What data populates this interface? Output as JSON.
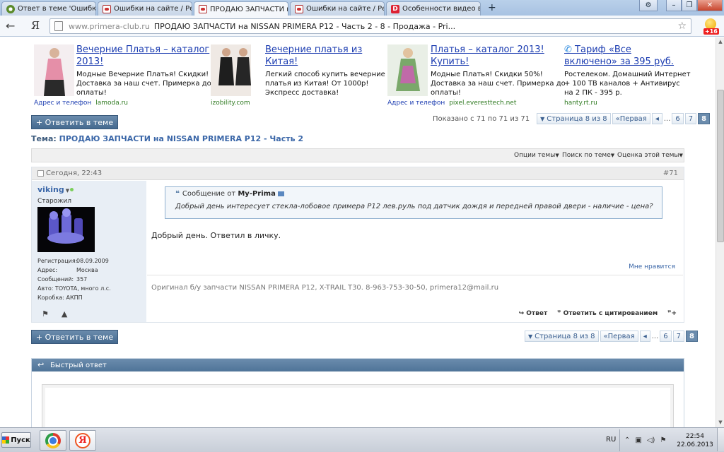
{
  "browser": {
    "tabs": [
      {
        "title": "Ответ в теме 'Ошибки с",
        "icon": "opera"
      },
      {
        "title": "Ошибки на сайте / Реш",
        "icon": "drom"
      },
      {
        "title": "ПРОДАЮ ЗАПЧАСТИ на",
        "icon": "drom"
      },
      {
        "title": "Ошибки на сайте / Реш",
        "icon": "drom"
      },
      {
        "title": "Особенности видео в л",
        "icon": "red",
        "icon_letter": "D"
      }
    ],
    "new_tab": "+",
    "close_glyph": "×",
    "nav_back": "←",
    "yandex_mark": "Я",
    "url_domain": "www.primera-club.ru",
    "url_path": "ПРОДАЮ ЗАПЧАСТИ на NISSAN PRIMERA P12 - Часть 2 - 8 - Продажа - Pri...",
    "extension_badge": "+16"
  },
  "ads": [
    {
      "title": "Вечерние Платья – каталог 2013!",
      "desc_lines": [
        "Модные Вечерние Платья! Скидки!",
        "Доставка за наш счет. Примерка до",
        "оплаты!"
      ],
      "addr": "Адрес и телефон",
      "source": "lamoda.ru"
    },
    {
      "title": "Вечерние платья из Китая!",
      "desc_lines": [
        "Легкий способ купить вечерние",
        "платья из Китая! От 1000р!",
        "Экспресс доставка!"
      ],
      "addr": "",
      "source": "izobility.com"
    },
    {
      "title": "Платья – каталог 2013! Купить!",
      "desc_lines": [
        "Модные Платья! Скидки 50%!",
        "Доставка за наш счет. Примерка до",
        "оплаты!"
      ],
      "addr": "Адрес и телефон",
      "source": "pixel.everesttech.net"
    },
    {
      "title": "Тариф «Все включено» за 395 руб.",
      "desc_lines": [
        "Ростелеком. Домашний Интернет",
        "+ 100 ТВ каналов + Антивирус",
        "на 2 ПК - 395 р."
      ],
      "addr": "",
      "source": "hanty.rt.ru"
    }
  ],
  "forum": {
    "reply_button": "+ Ответить в теме",
    "showing": "Показано с 71 по 71 из 71",
    "pager": {
      "page_label": "Страница 8 из 8",
      "first": "Первая",
      "prev": "◂",
      "ellipsis": "...",
      "pages": [
        "6",
        "7",
        "8"
      ],
      "current": "8"
    },
    "theme_label": "Тема:",
    "theme_name": "ПРОДАЮ ЗАПЧАСТИ на NISSAN PRIMERA P12 - Часть 2",
    "options": [
      "Опции темы",
      "Поиск по теме",
      "Оценка этой темы"
    ],
    "post": {
      "date": "Сегодня, 22:43",
      "number": "#71",
      "username": "viking",
      "rank": "Старожил",
      "user_info": [
        {
          "label": "Регистрация:",
          "value": "08.09.2009"
        },
        {
          "label": "Адрес:",
          "value": "Москва"
        },
        {
          "label": "Сообщений:",
          "value": "357"
        },
        {
          "label": "Авто:",
          "value": "TOYOTA, много л.с."
        },
        {
          "label": "Коробка:",
          "value": "АКПП"
        }
      ],
      "quote_prefix": "Сообщение от",
      "quote_author": "My-Prima",
      "quote_text": "Добрый день интересует стекла-лобовое примера P12 лев.руль под датчик дождя и передней правой двери - наличие - цена?",
      "text": "Добрый день. Ответил в личку.",
      "like": "Мне нравится",
      "signature": "Оригинал б/у запчасти NISSAN PRIMERA P12, X-TRAIL T30. 8-963-753-30-50, primera12@mail.ru",
      "reply": "Ответ",
      "reply_quote": "Ответить с цитированием"
    },
    "quick_reply": "Быстрый ответ"
  },
  "taskbar": {
    "start": "Пуск",
    "lang": "RU",
    "time": "22:54",
    "date": "22.06.2013"
  },
  "colors": {
    "link": "#1a3bb0",
    "forum_blue": "#3b67a8",
    "button": "#4f7498"
  }
}
